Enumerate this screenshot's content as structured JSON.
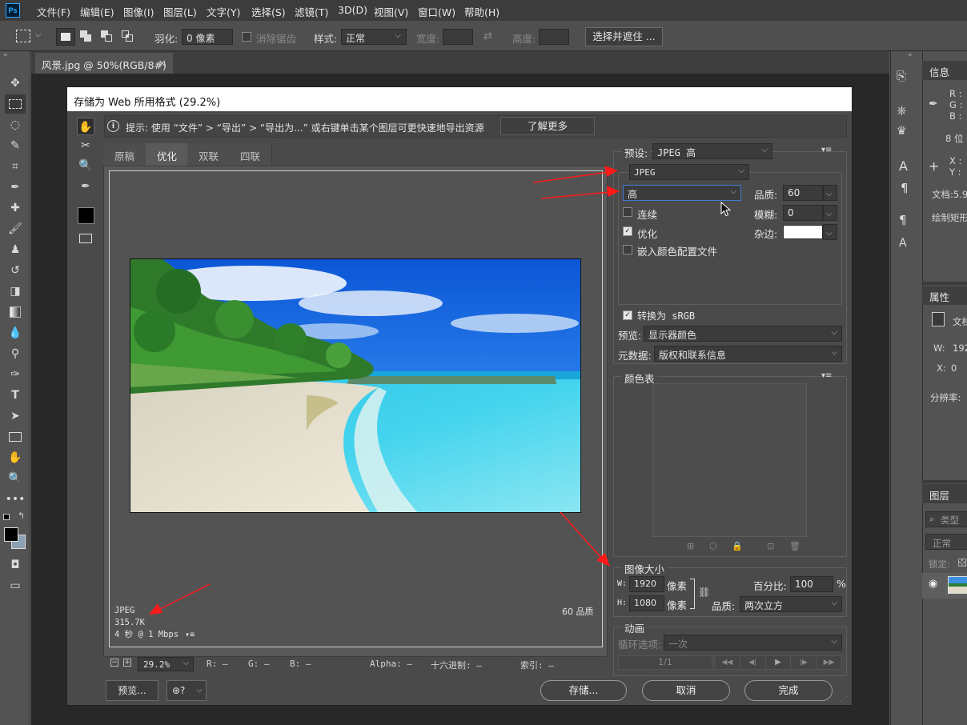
{
  "app": {
    "logo": "Ps"
  },
  "menu": [
    "文件(F)",
    "编辑(E)",
    "图像(I)",
    "图层(L)",
    "文字(Y)",
    "选择(S)",
    "滤镜(T)",
    "3D(D)",
    "视图(V)",
    "窗口(W)",
    "帮助(H)"
  ],
  "options": {
    "feather_label": "羽化:",
    "feather_value": "0 像素",
    "antialias_label": "消除锯齿",
    "style_label": "样式:",
    "style_value": "正常",
    "width_label": "宽度:",
    "height_label": "高度:",
    "select_mask_button": "选择并遮住 ..."
  },
  "document_tab": {
    "title": "风景.jpg @ 50%(RGB/8#)",
    "close": "×"
  },
  "right_panels": {
    "info_tab": "信息",
    "info_rgb": [
      "R :",
      "G :",
      "B :"
    ],
    "bits": "8 位",
    "xy": [
      "X :",
      "Y :"
    ],
    "doc_size": "文档:5.9",
    "draw_rect": "绘制矩形",
    "properties_tab": "属性",
    "doc_label": "文档",
    "w_label": "W:",
    "w_value": "192",
    "x_label": "X:",
    "x_value": "0",
    "resolution": "分辨率:",
    "layers_tab": "图层",
    "kind_search": "类型",
    "blend_mode": "正常",
    "lock_label": "锁定:"
  },
  "dialog": {
    "title": "存储为 Web 所用格式 (29.2%)",
    "hint": "提示:  使用 “文件” > “导出” > “导出为...” 或右键单击某个图层可更快速地导出资源",
    "learn_more": "了解更多",
    "view_tabs": [
      "原稿",
      "优化",
      "双联",
      "四联"
    ],
    "active_tab": "优化",
    "info_left": [
      "JPEG",
      "315.7K",
      "4 秒 @ 1 Mbps"
    ],
    "info_right": "60 品质",
    "zoom": "29.2%",
    "readouts": [
      "R: —",
      "G: —",
      "B: —",
      "Alpha: —",
      "十六进制: —",
      "索引: —"
    ],
    "preview_button": "预览...",
    "save_button": "存储...",
    "cancel_button": "取消",
    "done_button": "完成",
    "preset_label": "预设:",
    "preset_value": "JPEG 高",
    "format_value": "JPEG",
    "quality_preset": "高",
    "quality_label": "品质:",
    "quality_value": "60",
    "blur_label": "模糊:",
    "blur_value": "0",
    "matte_label": "杂边:",
    "progressive": "连续",
    "optimized": "优化",
    "embed_profile": "嵌入颜色配置文件",
    "convert_srgb": "转换为 sRGB",
    "preview_label": "预览:",
    "preview_value": "显示器颜色",
    "metadata_label": "元数据:",
    "metadata_value": "版权和联系信息",
    "color_table": "颜色表",
    "image_size": "图像大小",
    "w_label": "W:",
    "width_value": "1920",
    "h_label": "H:",
    "height_value": "1080",
    "px": "像素",
    "percent_label": "百分比:",
    "percent_value": "100",
    "percent_sign": "%",
    "resample_label": "品质:",
    "resample_value": "两次立方",
    "animation": "动画",
    "loop_label": "循环选项:",
    "loop_value": "一次",
    "frame_counter": "1/1"
  },
  "colors": {
    "accent": "#31a8ff",
    "arrow": "#ff1a1a",
    "dialog_bg": "#4a4a4a"
  }
}
